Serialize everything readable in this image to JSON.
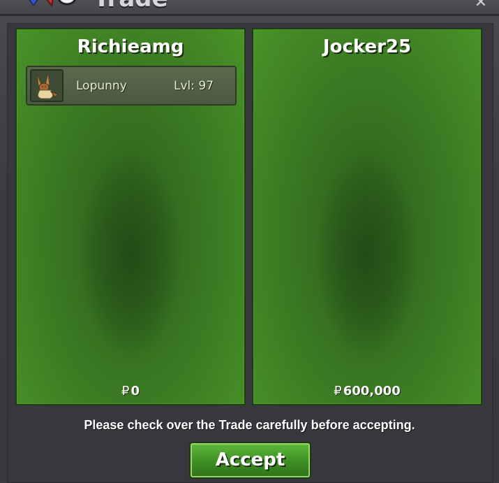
{
  "window": {
    "title": "Trade"
  },
  "offers": [
    {
      "trader": "Richieamg",
      "pokemon": [
        {
          "name": "Lopunny",
          "level": "Lvl: 97",
          "icon": "lopunny-sprite"
        }
      ],
      "currency_symbol": "₽",
      "money": "0"
    },
    {
      "trader": "Jocker25",
      "pokemon": [],
      "currency_symbol": "₽",
      "money": "600,000"
    }
  ],
  "notice": "Please check over the Trade carefully before accepting.",
  "accept_label": "Accept",
  "colors": {
    "panel_green": "#3b7a22",
    "button_green": "#3e8e23",
    "window_bg": "#37373d"
  }
}
